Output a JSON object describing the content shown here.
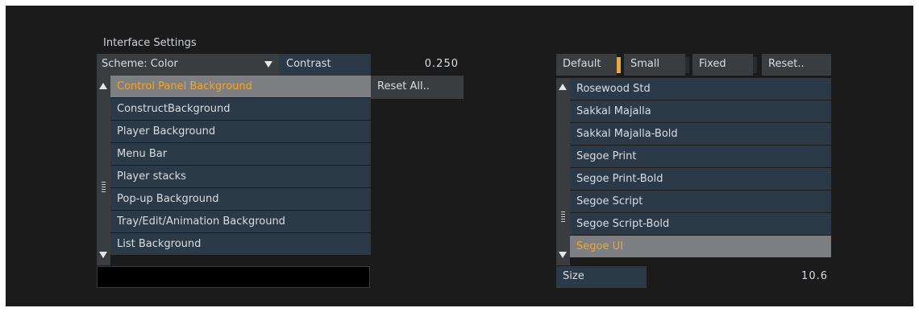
{
  "left_panel": {
    "title": "Interface Settings",
    "scheme_label": "Scheme: Color",
    "contrast_label": "Contrast",
    "contrast_value": "0.250",
    "reset_all_label": "Reset All..",
    "items": [
      {
        "label": "Control Panel Background",
        "selected": true
      },
      {
        "label": "ConstructBackground",
        "selected": false
      },
      {
        "label": "Player Background",
        "selected": false
      },
      {
        "label": "Menu Bar",
        "selected": false
      },
      {
        "label": "Player stacks",
        "selected": false
      },
      {
        "label": "Pop-up Background",
        "selected": false
      },
      {
        "label": "Tray/Edit/Animation Background",
        "selected": false
      },
      {
        "label": "List Background",
        "selected": false
      }
    ]
  },
  "right_panel": {
    "toolbar": {
      "default_label": "Default",
      "small_label": "Small",
      "fixed_label": "Fixed",
      "reset_label": "Reset.."
    },
    "fonts": [
      {
        "label": "Rosewood Std",
        "selected": false
      },
      {
        "label": "Sakkal Majalla",
        "selected": false
      },
      {
        "label": "Sakkal Majalla-Bold",
        "selected": false
      },
      {
        "label": "Segoe Print",
        "selected": false
      },
      {
        "label": "Segoe Print-Bold",
        "selected": false
      },
      {
        "label": "Segoe Script",
        "selected": false
      },
      {
        "label": "Segoe Script-Bold",
        "selected": false
      },
      {
        "label": "Segoe UI",
        "selected": true
      }
    ],
    "size_label": "Size",
    "size_value": "10.6"
  },
  "colors": {
    "accent": "#f5a623",
    "row_bg": "#2c3a48",
    "selected_bg": "#7d7f82",
    "panel_bg": "#1b1b1b"
  }
}
